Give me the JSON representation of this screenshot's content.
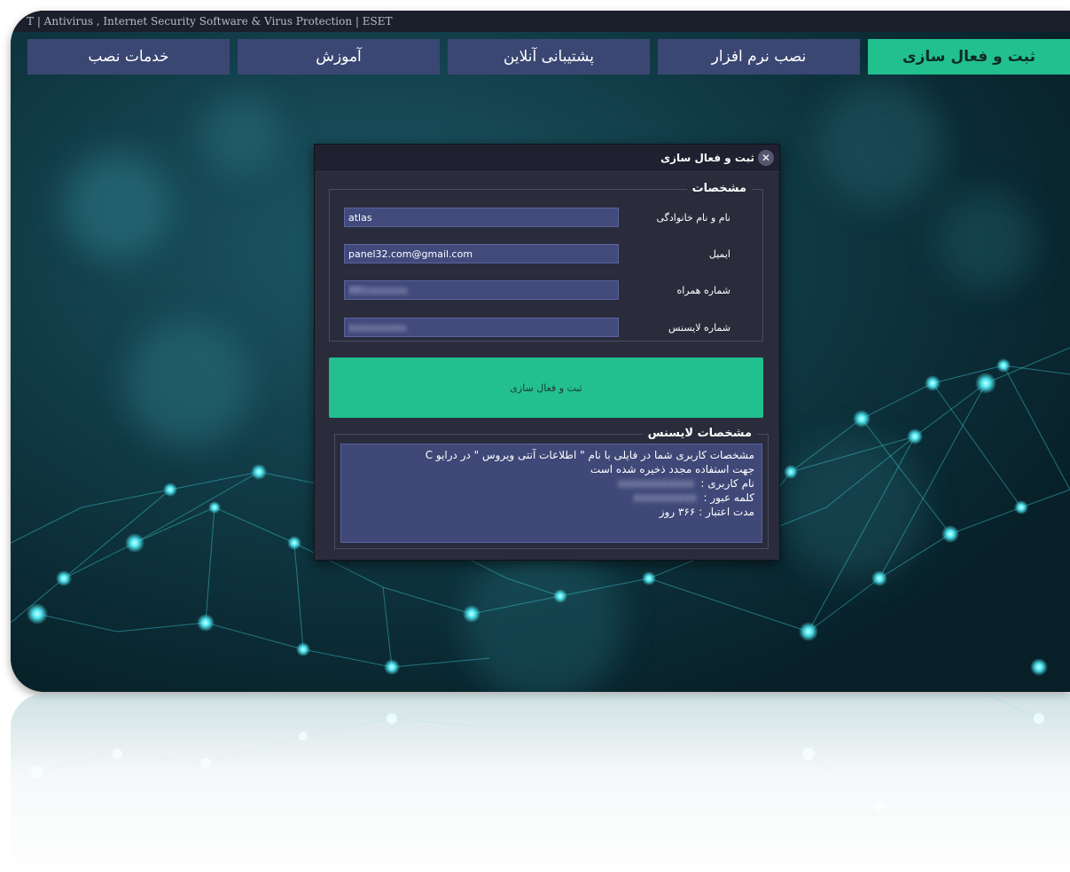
{
  "window": {
    "title": "T | Antivirus , Internet Security Software & Virus Protection | ESET"
  },
  "tabs": [
    {
      "label": "ثبت و فعال سازی",
      "active": true
    },
    {
      "label": "نصب نرم افزار",
      "active": false
    },
    {
      "label": "پشتیبانی آنلاین",
      "active": false
    },
    {
      "label": "آموزش",
      "active": false
    },
    {
      "label": "خدمات نصب",
      "active": false
    }
  ],
  "dialog": {
    "title": "ثبت و فعال سازی",
    "close_icon": "close-icon",
    "info_section": {
      "legend": "مشخصات",
      "fields": [
        {
          "label": "نام و نام خانوادگی",
          "value": "atlas",
          "blurred": false
        },
        {
          "label": "ایمیل",
          "value": "panel32.com@gmail.com",
          "blurred": false
        },
        {
          "label": "شماره همراه",
          "value": "091xxxxxxx",
          "blurred": true
        },
        {
          "label": "شماره لایسنس",
          "value": "xxxxxxxxxx",
          "blurred": true
        }
      ]
    },
    "register_button": "ثبت و فعال سازی",
    "license_section": {
      "legend": "مشخصات لایسنس",
      "line1": "مشخصات کاربری شما در فایلی با نام \" اطلاعات آنتی ویروس \" در درایو C",
      "line2": "جهت استفاده مجدد ذخیره شده است",
      "username_label": "نام کاربری :",
      "username_value": "xxxxxxxxxxxx",
      "password_label": "کلمه عبور :",
      "password_value": "xxxxxxxxxx",
      "validity": "مدت اعتبار : ۳۶۶ روز"
    }
  },
  "colors": {
    "accent": "#22c08f",
    "tab": "#3b4773",
    "dialog_bg": "#2a2b3b",
    "input_bg": "#424a7c"
  }
}
